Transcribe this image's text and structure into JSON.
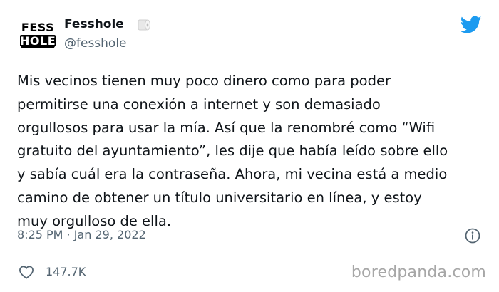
{
  "tweet": {
    "avatar": {
      "line1": "FESS",
      "line2": "HOLE"
    },
    "display_name": "Fesshole",
    "name_emoji_icon": "toilet-roll-icon",
    "handle": "@fesshole",
    "platform_icon": "twitter-bird-icon",
    "brand_color": "#1d9bf0",
    "text": "Mis vecinos tienen muy poco dinero como para poder\npermitirse una conexión a internet y son demasiado\norgullosos para usar la mía. Así que la renombré como “Wifi\ngratuito del ayuntamiento”, les dije que había leído sobre ello\ny sabía cuál era la contraseña. Ahora, mi vecina está a medio\ncamino de obtener un título universitario en línea, y estoy\nmuy orgulloso de ella.",
    "timestamp": "8:25 PM · Jan 29, 2022",
    "info_icon": "info-icon",
    "like_icon": "heart-icon",
    "like_count": "147.7K"
  },
  "watermark": "boredpanda.com"
}
